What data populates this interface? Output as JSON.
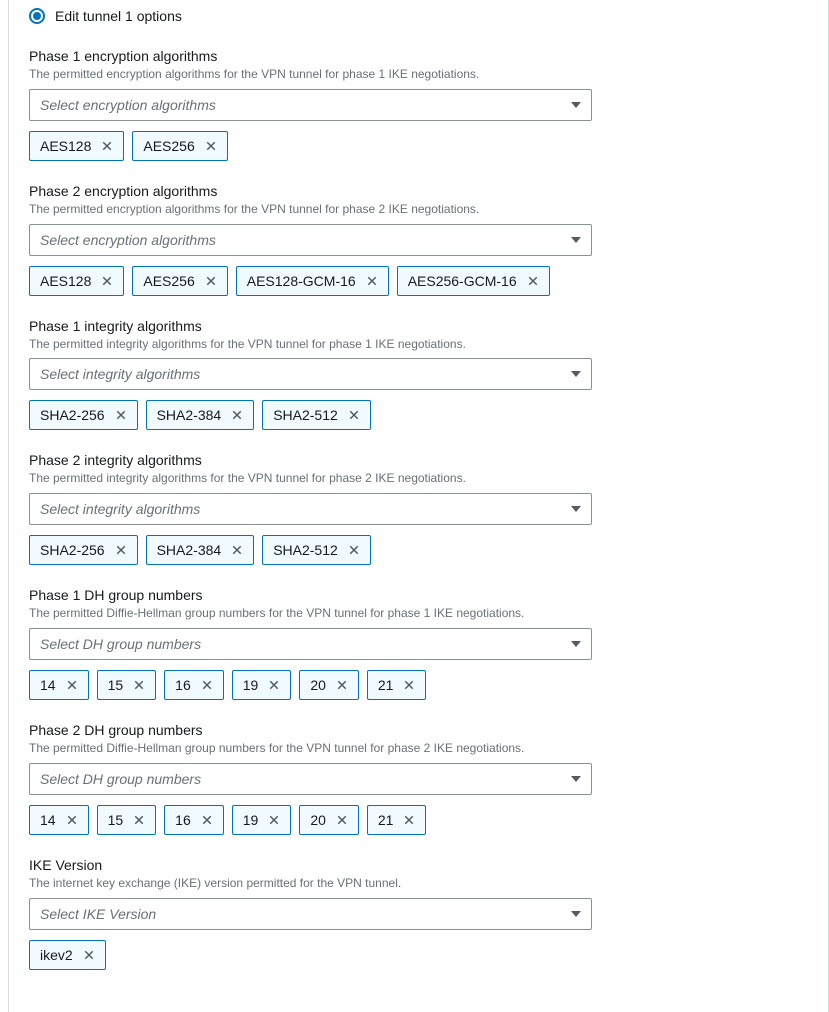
{
  "radio": {
    "label": "Edit tunnel 1 options"
  },
  "sections": [
    {
      "key": "p1enc",
      "label": "Phase 1 encryption algorithms",
      "desc": "The permitted encryption algorithms for the VPN tunnel for phase 1 IKE negotiations.",
      "placeholder": "Select encryption algorithms",
      "tokens": [
        "AES128",
        "AES256"
      ]
    },
    {
      "key": "p2enc",
      "label": "Phase 2 encryption algorithms",
      "desc": "The permitted encryption algorithms for the VPN tunnel for phase 2 IKE negotiations.",
      "placeholder": "Select encryption algorithms",
      "tokens": [
        "AES128",
        "AES256",
        "AES128-GCM-16",
        "AES256-GCM-16"
      ]
    },
    {
      "key": "p1int",
      "label": "Phase 1 integrity algorithms",
      "desc": "The permitted integrity algorithms for the VPN tunnel for phase 1 IKE negotiations.",
      "placeholder": "Select integrity algorithms",
      "tokens": [
        "SHA2-256",
        "SHA2-384",
        "SHA2-512"
      ]
    },
    {
      "key": "p2int",
      "label": "Phase 2 integrity algorithms",
      "desc": "The permitted integrity algorithms for the VPN tunnel for phase 2 IKE negotiations.",
      "placeholder": "Select integrity algorithms",
      "tokens": [
        "SHA2-256",
        "SHA2-384",
        "SHA2-512"
      ]
    },
    {
      "key": "p1dh",
      "label": "Phase 1 DH group numbers",
      "desc": "The permitted Diffie-Hellman group numbers for the VPN tunnel for phase 1 IKE negotiations.",
      "placeholder": "Select DH group numbers",
      "tokens": [
        "14",
        "15",
        "16",
        "19",
        "20",
        "21"
      ]
    },
    {
      "key": "p2dh",
      "label": "Phase 2 DH group numbers",
      "desc": "The permitted Diffie-Hellman group numbers for the VPN tunnel for phase 2 IKE negotiations.",
      "placeholder": "Select DH group numbers",
      "tokens": [
        "14",
        "15",
        "16",
        "19",
        "20",
        "21"
      ]
    },
    {
      "key": "ike",
      "label": "IKE Version",
      "desc": "The internet key exchange (IKE) version permitted for the VPN tunnel.",
      "placeholder": "Select IKE Version",
      "tokens": [
        "ikev2"
      ]
    }
  ]
}
